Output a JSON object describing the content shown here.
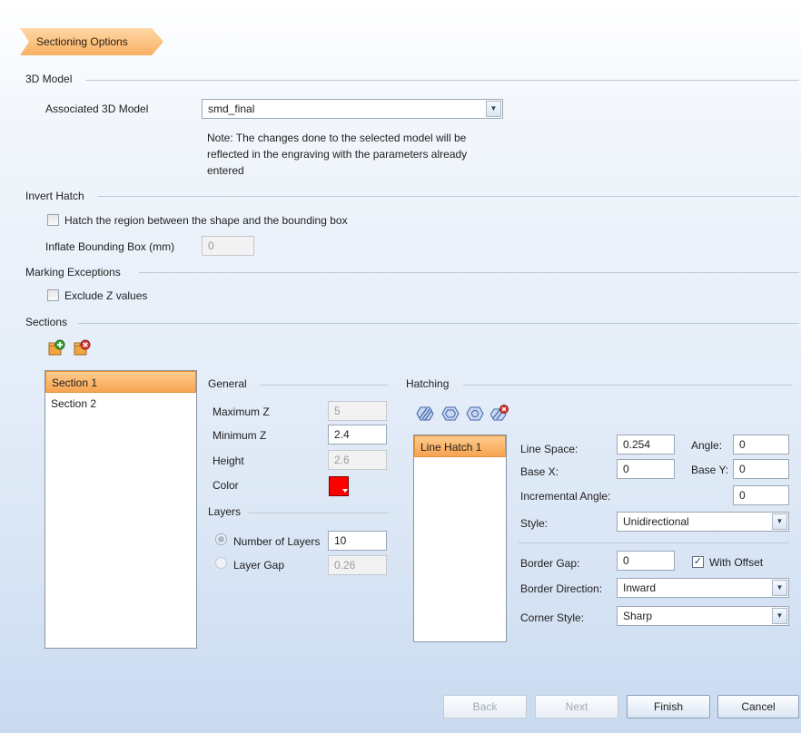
{
  "header": {
    "title": "Sectioning Options"
  },
  "model": {
    "group_label": "3D Model",
    "associated_label": "Associated 3D Model",
    "associated_value": "smd_final",
    "note_line1": "Note: The changes done to the selected model will be",
    "note_line2": "reflected in the engraving with the parameters already",
    "note_line3": "entered"
  },
  "invert_hatch": {
    "group_label": "Invert Hatch",
    "checkbox_label": "Hatch the region between the shape and the bounding box",
    "inflate_label": "Inflate Bounding Box  (mm)",
    "inflate_value": "0"
  },
  "marking_exceptions": {
    "group_label": "Marking Exceptions",
    "exclude_z_label": "Exclude Z values"
  },
  "sections": {
    "group_label": "Sections",
    "items": [
      {
        "label": "Section 1"
      },
      {
        "label": "Section 2"
      }
    ]
  },
  "general": {
    "group_label": "General",
    "max_z_label": "Maximum Z",
    "max_z_value": "5",
    "min_z_label": "Minimum Z",
    "min_z_value": "2.4",
    "height_label": "Height",
    "height_value": "2.6",
    "color_label": "Color",
    "color_value": "#ff0000"
  },
  "layers": {
    "group_label": "Layers",
    "num_layers_label": "Number of Layers",
    "num_layers_value": "10",
    "layer_gap_label": "Layer Gap",
    "layer_gap_value": "0.26"
  },
  "hatching": {
    "group_label": "Hatching",
    "items": [
      {
        "label": "Line Hatch 1"
      }
    ],
    "line_space_label": "Line Space:",
    "line_space_value": "0.254",
    "angle_label": "Angle:",
    "angle_value": "0",
    "base_x_label": "Base X:",
    "base_x_value": "0",
    "base_y_label": "Base Y:",
    "base_y_value": "0",
    "inc_angle_label": "Incremental Angle:",
    "inc_angle_value": "0",
    "style_label": "Style:",
    "style_value": "Unidirectional",
    "border_gap_label": "Border Gap:",
    "border_gap_value": "0",
    "with_offset_label": "With Offset",
    "border_dir_label": "Border Direction:",
    "border_dir_value": "Inward",
    "corner_style_label": "Corner Style:",
    "corner_style_value": "Sharp"
  },
  "footer": {
    "back": "Back",
    "next": "Next",
    "finish": "Finish",
    "cancel": "Cancel"
  }
}
